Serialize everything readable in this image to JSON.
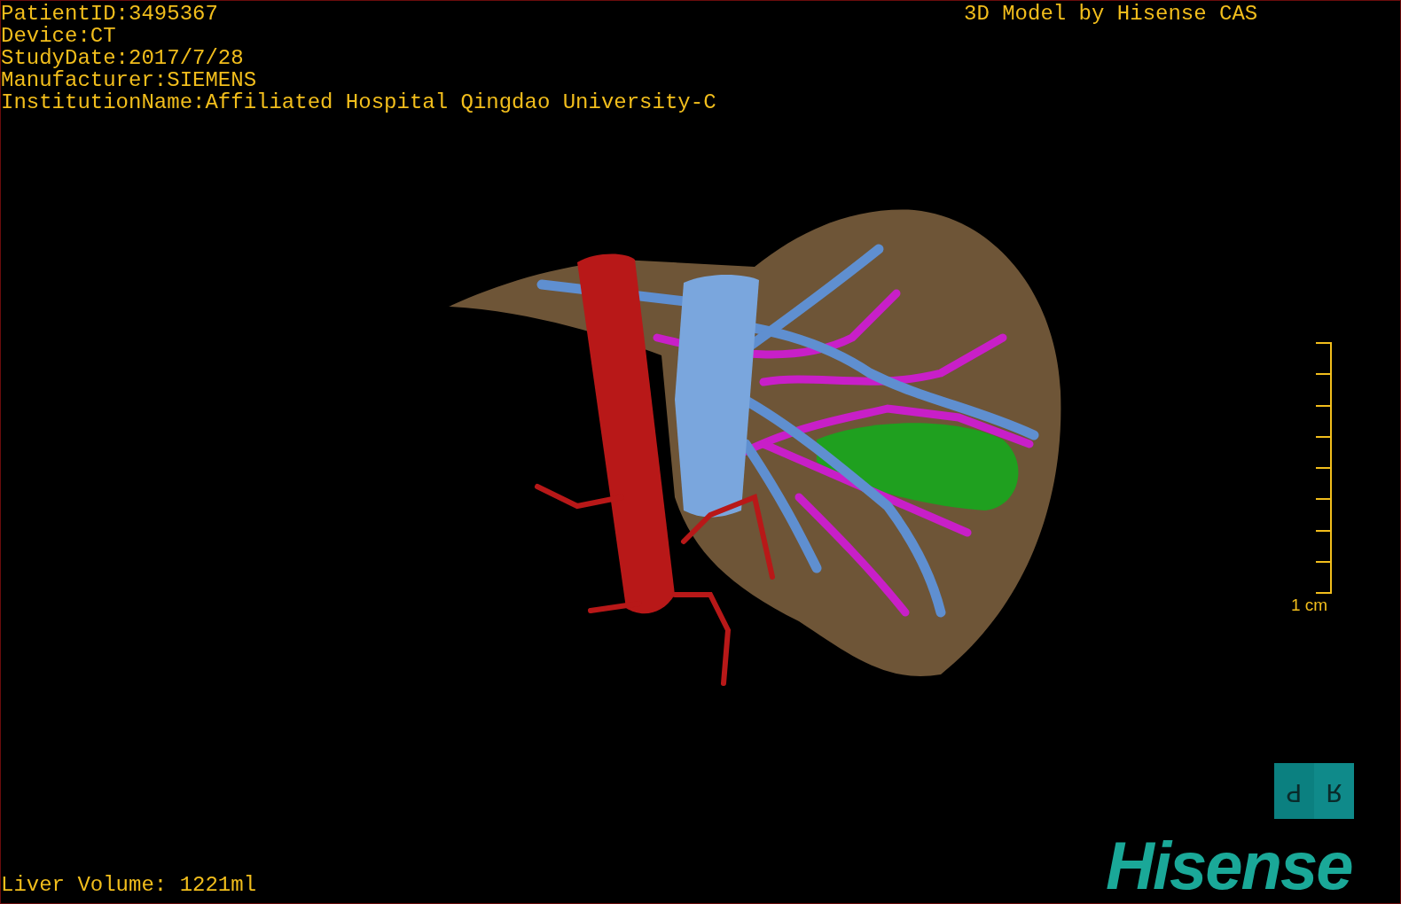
{
  "patient_info": [
    "PatientID:3495367",
    "Device:CT",
    "StudyDate:2017/7/28",
    "Manufacturer:SIEMENS",
    "InstitutionName:Affiliated Hospital Qingdao University-C"
  ],
  "credit": "3D Model by Hisense CAS",
  "scale_bar": {
    "label": "1 cm"
  },
  "orientation_cube": {
    "faces": [
      "P",
      "R"
    ]
  },
  "liver_volume": "Liver Volume: 1221ml",
  "logo": "Hisense"
}
